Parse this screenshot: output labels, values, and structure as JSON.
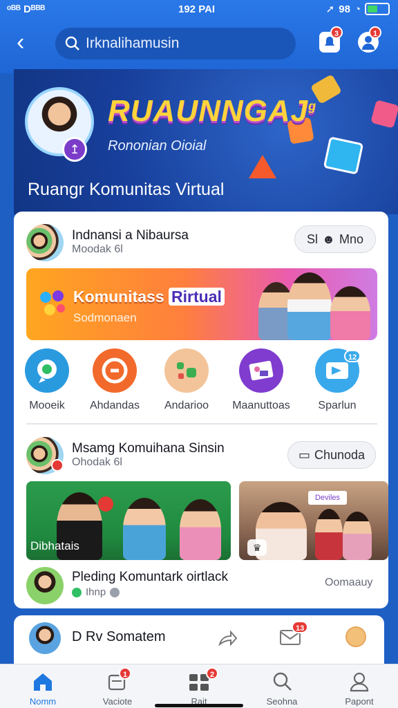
{
  "status": {
    "left": "ᵒᴮᴮ Dᴮᴮᴮ",
    "time": "192 PAI",
    "right": "98"
  },
  "header": {
    "search_text": "Irknalihamusin",
    "notif_badge": "3",
    "profile_badge": "1"
  },
  "hero": {
    "logo": "RUAUNNGAJ",
    "logo_mark": "g",
    "subtitle": "Rononian Oioial",
    "caption": "Ruangr Komunitas Virtual"
  },
  "feed1": {
    "name": "Indnansi a Nibaursa",
    "meta": "Moodak 6l",
    "pill": "Sl",
    "pill_text": "Mno",
    "banner_title_a": "Komunitass",
    "banner_title_b": "Rirtual",
    "banner_subtitle": "Sodmonaen"
  },
  "shortcuts": [
    {
      "label": "Mooeik",
      "color": "#2a9adf",
      "icon": "chat-icon"
    },
    {
      "label": "Ahdandas",
      "color": "#f26a2b",
      "icon": "music-icon"
    },
    {
      "label": "Andarioo",
      "color": "#f3c49a",
      "icon": "game-icon"
    },
    {
      "label": "Maanuttoas",
      "color": "#7f3ccf",
      "icon": "photo-icon"
    },
    {
      "label": "Sparlun",
      "color": "#3aa9ec",
      "icon": "send-icon"
    }
  ],
  "shortcut_badge": "12",
  "feed2": {
    "name": "Msamg Komuihana Sinsin",
    "meta": "Ohodak 6l",
    "pill": "Chunoda",
    "photo_caption": "Dibhatais",
    "photo2_sign": "Deviles"
  },
  "post": {
    "title": "Pleding Komuntark oirtlack",
    "meta": "Ihnp",
    "right": "Oomaauy"
  },
  "composer": {
    "text": "D Rv Somatem",
    "badge": "13"
  },
  "tabs": [
    {
      "label": "Nomm",
      "icon": "home-icon",
      "active": true,
      "badge": ""
    },
    {
      "label": "Vaciote",
      "icon": "document-icon",
      "active": false,
      "badge": "1"
    },
    {
      "label": "Rait",
      "icon": "grid-icon",
      "active": false,
      "badge": "2"
    },
    {
      "label": "Seohna",
      "icon": "search-icon",
      "active": false,
      "badge": ""
    },
    {
      "label": "Papont",
      "icon": "person-icon",
      "active": false,
      "badge": ""
    }
  ],
  "colors": {
    "primary": "#1f66d6",
    "accent": "#ffd43b",
    "badge": "#e53935"
  }
}
